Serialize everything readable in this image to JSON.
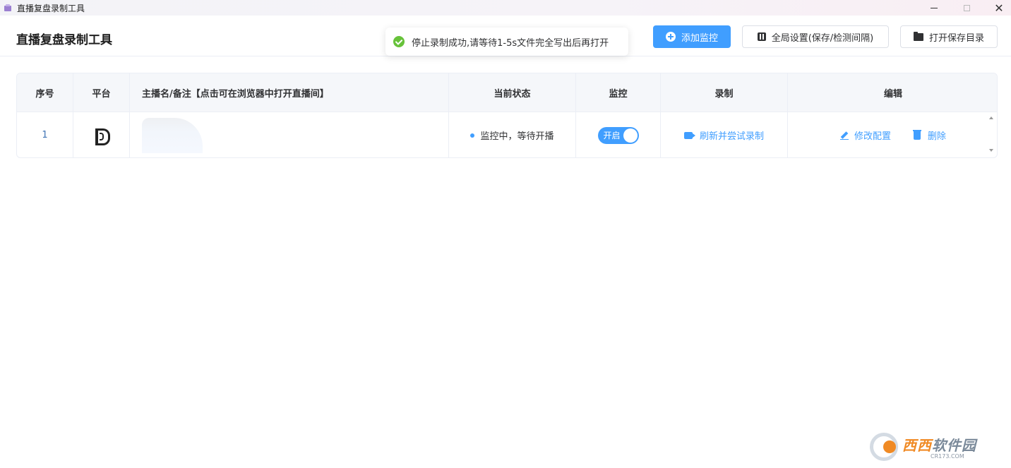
{
  "window": {
    "title": "直播复盘录制工具"
  },
  "header": {
    "title": "直播复盘录制工具",
    "add_button": "添加监控",
    "settings_button": "全局设置(保存/检测间隔)",
    "open_folder_button": "打开保存目录"
  },
  "toast": {
    "message": "停止录制成功,请等待1-5s文件完全写出后再打开",
    "type": "success"
  },
  "table": {
    "columns": [
      "序号",
      "平台",
      "主播名/备注【点击可在浏览器中打开直播间】",
      "当前状态",
      "监控",
      "录制",
      "编辑"
    ],
    "rows": [
      {
        "index": "1",
        "platform_icon": "platform-logo-icon",
        "status": "监控中，等待开播",
        "monitor_toggle": "开启",
        "monitor_on": true,
        "record_action": "刷新并尝试录制",
        "edit_action": "修改配置",
        "delete_action": "删除"
      }
    ]
  },
  "watermark": {
    "brand_a": "西西",
    "brand_b": "软件园",
    "site": "CR173.COM"
  },
  "colors": {
    "primary": "#409eff",
    "success": "#67c23a"
  }
}
